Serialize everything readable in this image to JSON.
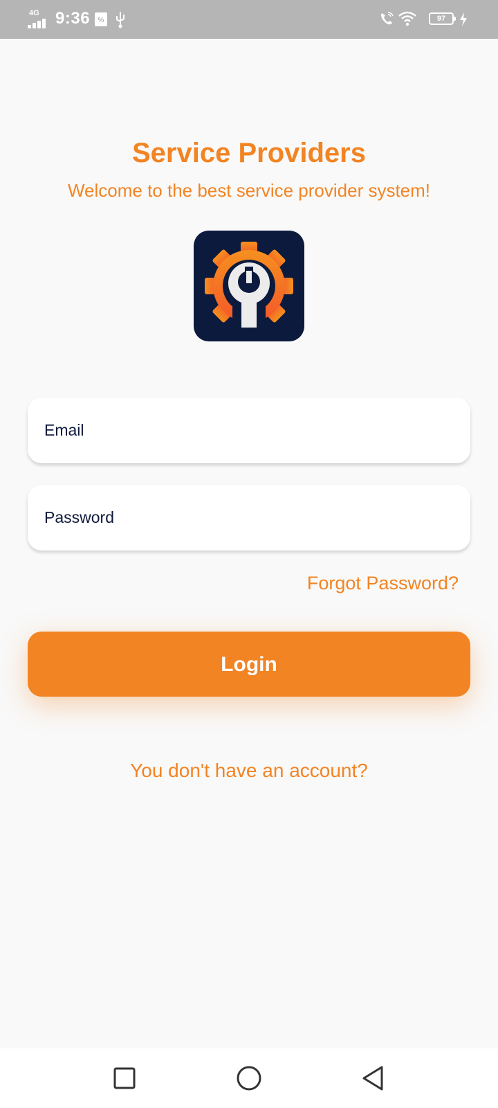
{
  "status_bar": {
    "network": "4G",
    "time": "9:36",
    "battery_level": "97",
    "icons": [
      "signal-icon",
      "sim-icon",
      "usb-icon",
      "wifi-call-icon",
      "wifi-icon",
      "battery-icon",
      "charging-icon"
    ]
  },
  "header": {
    "title": "Service Providers",
    "subtitle": "Welcome to the best service provider system!"
  },
  "logo": {
    "icon": "gear-wrench-logo",
    "background": "#0b1a3d",
    "accent": "#f28423"
  },
  "form": {
    "email_placeholder": "Email",
    "password_placeholder": "Password",
    "forgot_password": "Forgot Password?",
    "login_label": "Login",
    "signup_prompt": "You don't have an account?"
  },
  "nav_bar": {
    "buttons": [
      "recents-square-icon",
      "home-circle-icon",
      "back-triangle-icon"
    ]
  },
  "colors": {
    "accent": "#f28423",
    "text_dark": "#0f1a3c",
    "background": "#f9f9f9",
    "status_bar": "#b5b5b5"
  }
}
